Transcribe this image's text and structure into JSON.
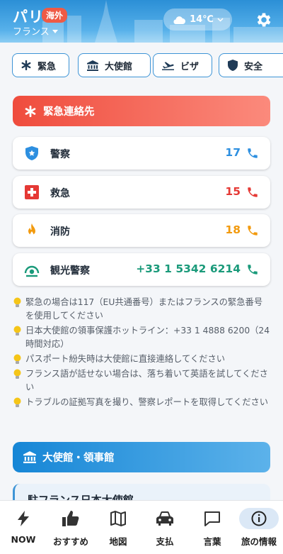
{
  "header": {
    "city": "パリ",
    "badge": "海外",
    "country": "フランス",
    "weather": "14℃"
  },
  "chips": [
    {
      "label": "緊急",
      "icon": "asterisk-icon"
    },
    {
      "label": "大使館",
      "icon": "bank-icon"
    },
    {
      "label": "ビザ",
      "icon": "plane-icon"
    },
    {
      "label": "安全",
      "icon": "shield-icon"
    }
  ],
  "emergency": {
    "title": "緊急連絡先",
    "contacts": [
      {
        "label": "警察",
        "number": "17",
        "color": "#2d8fe0",
        "icon": "police-badge-icon"
      },
      {
        "label": "救急",
        "number": "15",
        "color": "#e53935",
        "icon": "medical-cross-icon"
      },
      {
        "label": "消防",
        "number": "18",
        "color": "#f29a0e",
        "icon": "fire-icon"
      },
      {
        "label": "観光警察",
        "number": "+33 1 5342 6214",
        "color": "#1a9a7a",
        "icon": "tourist-police-icon"
      }
    ]
  },
  "tips": [
    "緊急の場合は117（EU共通番号）またはフランスの緊急番号を使用してください",
    "日本大使館の領事保護ホットライン：+33 1 4888 6200（24時間対応）",
    "パスポート紛失時は大使館に直接連絡してください",
    "フランス語が話せない場合は、落ち着いて英語を試してください",
    "トラブルの証拠写真を撮り、警察レポートを取得してください"
  ],
  "embassy": {
    "title": "大使館・領事館",
    "card_title": "駐フランス日本大使館"
  },
  "nav": [
    {
      "label": "NOW",
      "icon": "bolt-icon"
    },
    {
      "label": "おすすめ",
      "icon": "thumbs-up-icon"
    },
    {
      "label": "地図",
      "icon": "map-icon"
    },
    {
      "label": "支払",
      "icon": "car-icon"
    },
    {
      "label": "言葉",
      "icon": "chat-icon"
    },
    {
      "label": "旅の情報",
      "icon": "info-icon",
      "active": true
    }
  ]
}
